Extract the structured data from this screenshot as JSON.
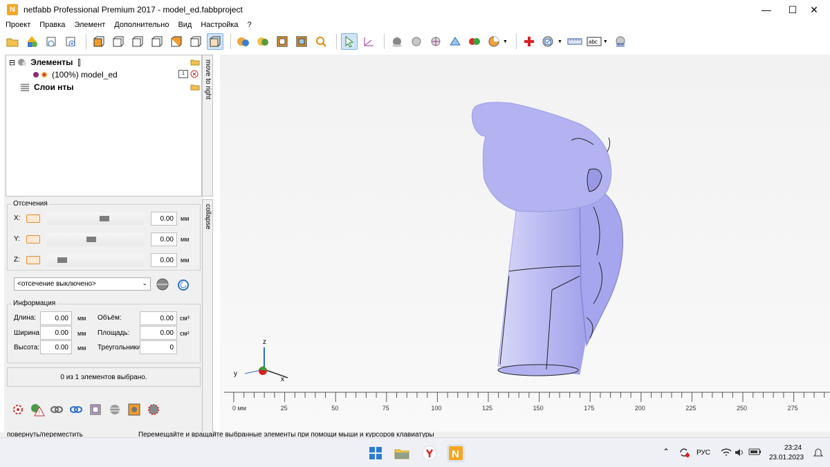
{
  "window": {
    "title": "netfabb Professional Premium 2017 - model_ed.fabbproject",
    "logo_letter": "N",
    "minimize": "—",
    "maximize": "☐",
    "close": "✕"
  },
  "menu": [
    "Проект",
    "Правка",
    "Элемент",
    "Дополнительно",
    "Вид",
    "Настройка",
    "?"
  ],
  "tree": {
    "root_label": "Элементы",
    "model_label": "(100%) model_ed",
    "model_badge": "1",
    "layers_label": "Слои нты",
    "expander": "⊟"
  },
  "side_tabs": {
    "move": "move to right",
    "collapse": "collapse"
  },
  "cutting": {
    "title": "Отсечения",
    "axes": [
      {
        "label": "X:",
        "value": "0.00",
        "unit": "мм",
        "thumb": 0.6
      },
      {
        "label": "Y:",
        "value": "0.00",
        "unit": "мм",
        "thumb": 0.45
      },
      {
        "label": "Z:",
        "value": "0.00",
        "unit": "мм",
        "thumb": 0.12
      }
    ],
    "mode": "<отсечение выключено>"
  },
  "info": {
    "title": "Информация",
    "length_label": "Длина:",
    "length_value": "0.00",
    "length_unit": "мм",
    "width_label": "Ширина:",
    "width_value": "0.00",
    "width_unit": "мм",
    "height_label": "Высота:",
    "height_value": "0.00",
    "height_unit": "мм",
    "volume_label": "Объём:",
    "volume_value": "0.00",
    "volume_unit": "см³",
    "area_label": "Площадь:",
    "area_value": "0.00",
    "area_unit": "см²",
    "triangles_label": "Треугольники",
    "triangles_value": "0"
  },
  "selection_status": "0 из 1 элементов выбрано.",
  "axes_gizmo": {
    "x": "x",
    "y": "y",
    "z": "z"
  },
  "ruler": {
    "unit_label": "0 мм",
    "ticks": [
      "25",
      "50",
      "75",
      "100",
      "125",
      "150",
      "175",
      "200",
      "225",
      "250",
      "275"
    ]
  },
  "status": {
    "left": "повернуть/переместить",
    "main": "Перемещайте и вращайте выбранные элементы при помощи мыши и курсоров клавиатуры"
  },
  "taskbar": {
    "language": "РУС",
    "time": "23:24",
    "date": "23.01.2023"
  },
  "colors": {
    "model": "#a9a9ef",
    "accent_orange": "#e08a2c",
    "active_tool": "#cfe4f7"
  }
}
